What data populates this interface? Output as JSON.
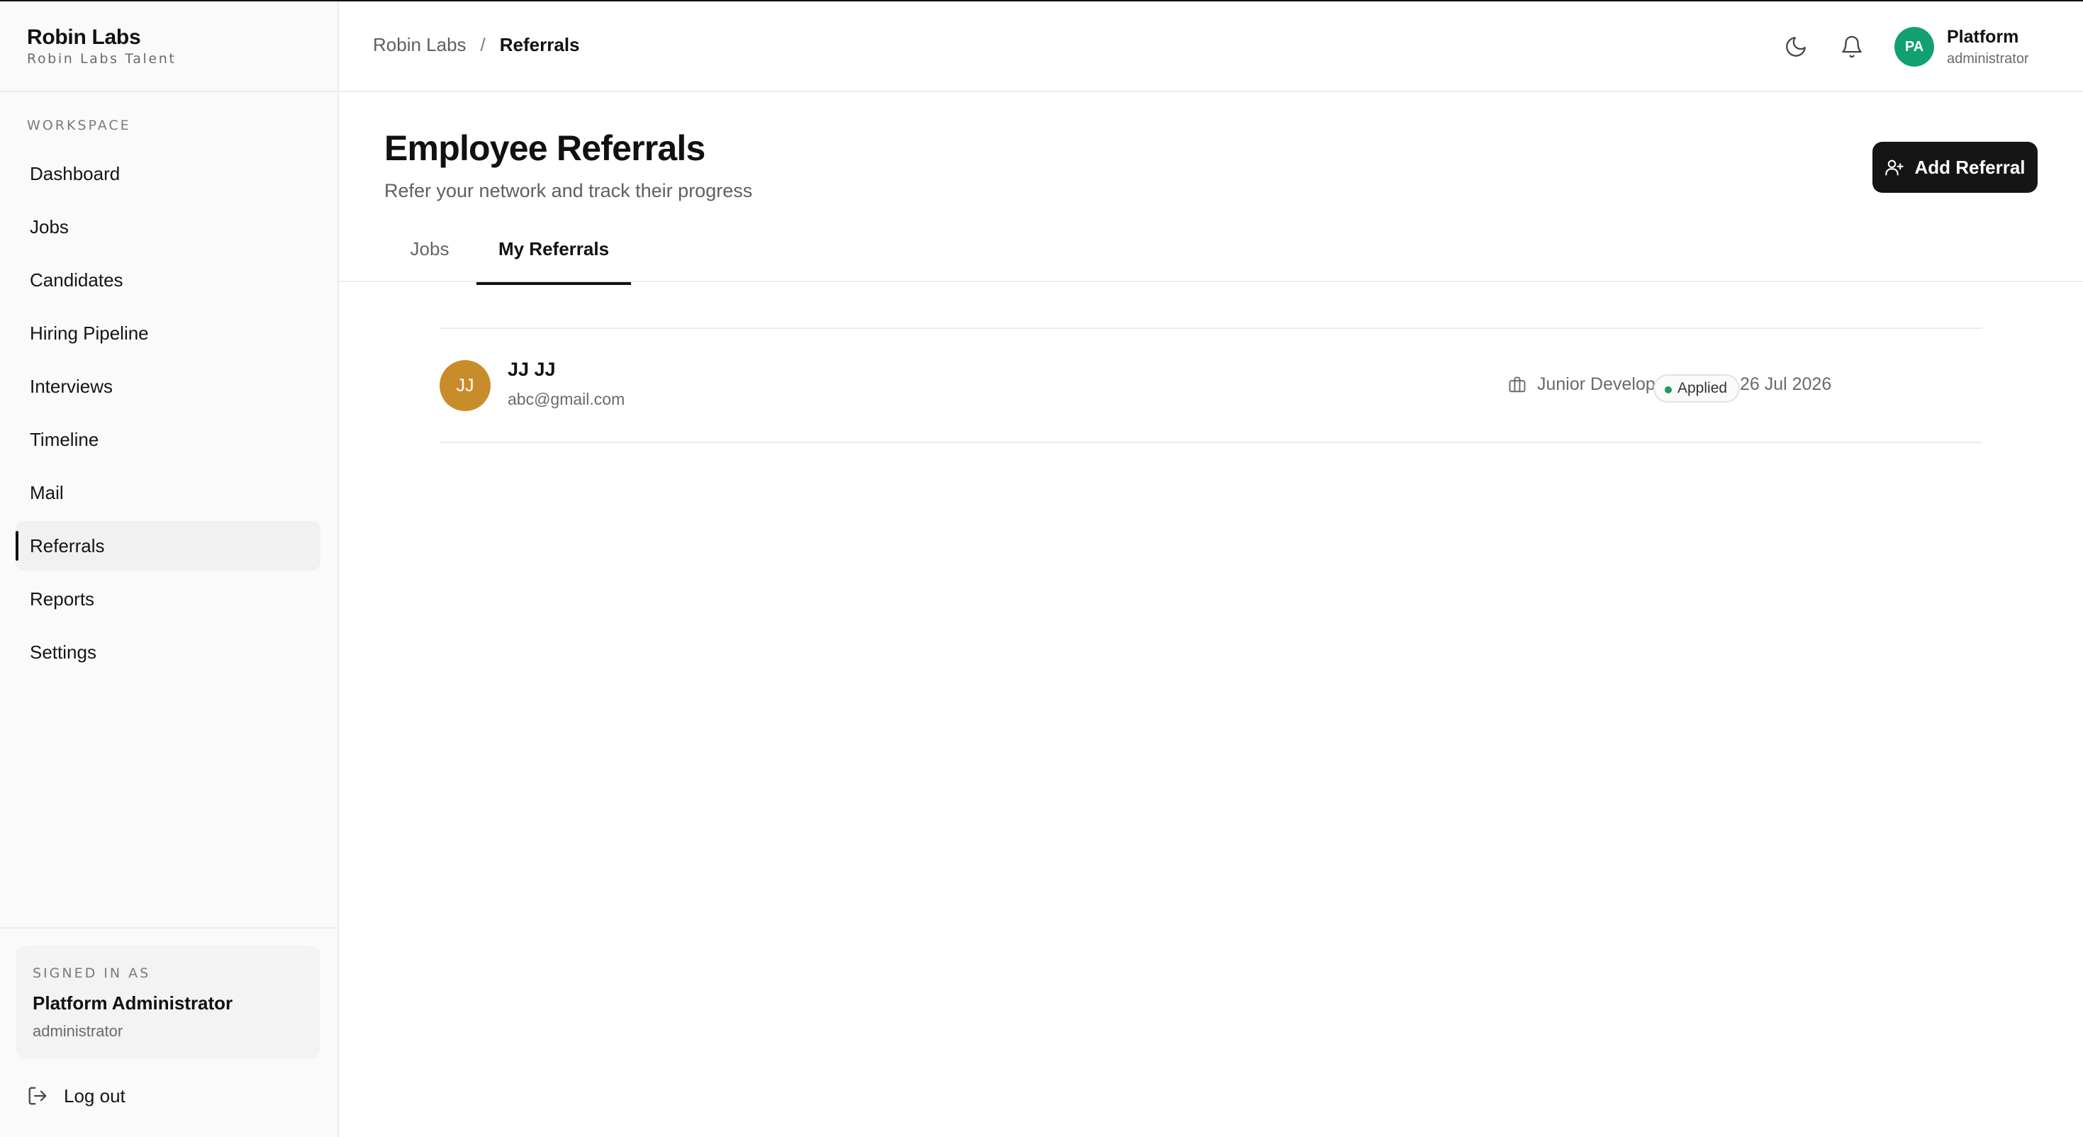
{
  "brand": {
    "name": "Robin Labs",
    "subtitle": "Robin Labs Talent"
  },
  "sidebar": {
    "section_label": "WORKSPACE",
    "items": [
      {
        "label": "Dashboard"
      },
      {
        "label": "Jobs"
      },
      {
        "label": "Candidates"
      },
      {
        "label": "Hiring Pipeline"
      },
      {
        "label": "Interviews"
      },
      {
        "label": "Timeline"
      },
      {
        "label": "Mail"
      },
      {
        "label": "Referrals"
      },
      {
        "label": "Reports"
      },
      {
        "label": "Settings"
      }
    ],
    "active_item": "Referrals",
    "signed_in": {
      "label": "SIGNED IN AS",
      "name": "Platform Administrator",
      "role": "administrator"
    },
    "logout_label": "Log out"
  },
  "header": {
    "breadcrumb_root": "Robin Labs",
    "breadcrumb_separator": "/",
    "breadcrumb_current": "Referrals",
    "theme_icon": "moon-icon",
    "notifications_icon": "bell-icon",
    "user": {
      "initials": "PA",
      "name": "Platform",
      "role": "administrator",
      "avatar_color": "#13a06f"
    }
  },
  "main": {
    "title": "Employee Referrals",
    "subtitle": "Refer your network and track their progress",
    "add_button_label": "Add Referral",
    "tabs": [
      {
        "label": "Jobs",
        "active": false
      },
      {
        "label": "My Referrals",
        "active": true
      }
    ],
    "referrals": [
      {
        "initials": "JJ",
        "name": "JJ JJ",
        "email": "abc@gmail.com",
        "job": "Junior Developer",
        "date": "26 Jul 2026",
        "status": "Applied",
        "avatar_color": "#c88d2a",
        "status_color": "#1a9c5d"
      }
    ]
  }
}
